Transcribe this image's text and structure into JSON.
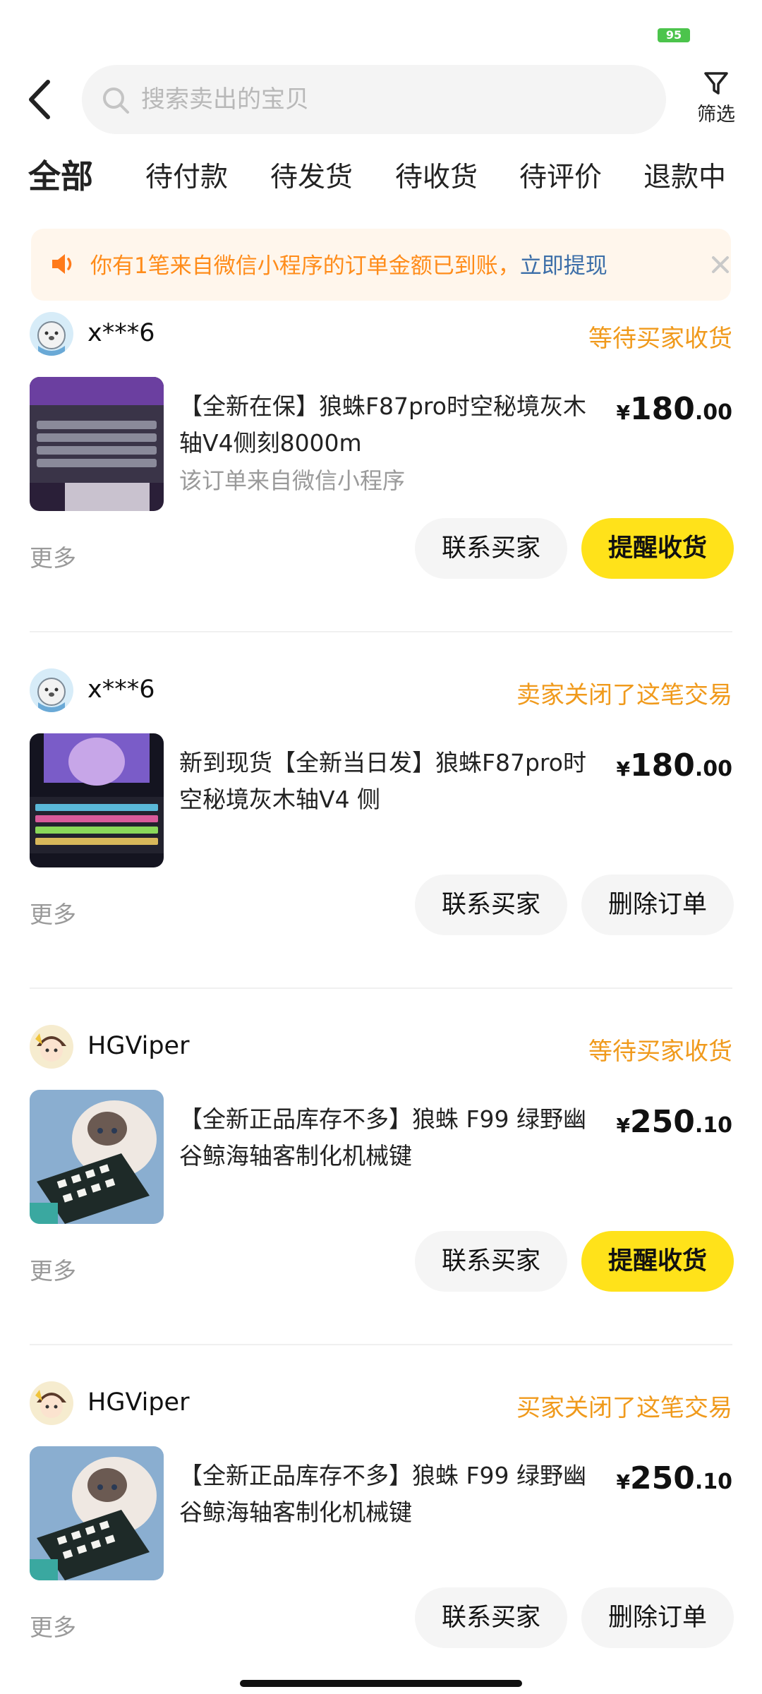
{
  "status_bar": {
    "battery": "95"
  },
  "search": {
    "placeholder": "搜索卖出的宝贝"
  },
  "filter": {
    "label": "筛选"
  },
  "tabs": [
    "全部",
    "待付款",
    "待发货",
    "待收货",
    "待评价",
    "退款中"
  ],
  "notice": {
    "text": "你有1笔来自微信小程序的订单金额已到账，",
    "link": "立即提现"
  },
  "orders": [
    {
      "buyer": "x***6",
      "status": "等待买家收货",
      "title": "【全新在保】狼蛛F87pro时空秘境灰木轴V4侧刻8000m",
      "subtitle": "该订单来自微信小程序",
      "price_currency": "¥",
      "price_int": "180",
      "price_dec": ".00",
      "more": "更多",
      "btn_secondary": "联系买家",
      "btn_primary": "提醒收货"
    },
    {
      "buyer": "x***6",
      "status": "卖家关闭了这笔交易",
      "title": "新到现货【全新当日发】狼蛛F87pro时空秘境灰木轴V4 侧",
      "price_currency": "¥",
      "price_int": "180",
      "price_dec": ".00",
      "more": "更多",
      "btn_secondary": "联系买家",
      "btn_primary": "删除订单"
    },
    {
      "buyer": "HGViper",
      "status": "等待买家收货",
      "title": "【全新正品库存不多】狼蛛 F99 绿野幽谷鲸海轴客制化机械键",
      "price_currency": "¥",
      "price_int": "250",
      "price_dec": ".10",
      "more": "更多",
      "btn_secondary": "联系买家",
      "btn_primary": "提醒收货"
    },
    {
      "buyer": "HGViper",
      "status": "买家关闭了这笔交易",
      "title": "【全新正品库存不多】狼蛛 F99 绿野幽谷鲸海轴客制化机械键",
      "price_currency": "¥",
      "price_int": "250",
      "price_dec": ".10",
      "more": "更多",
      "btn_secondary": "联系买家",
      "btn_primary": "删除订单"
    }
  ]
}
